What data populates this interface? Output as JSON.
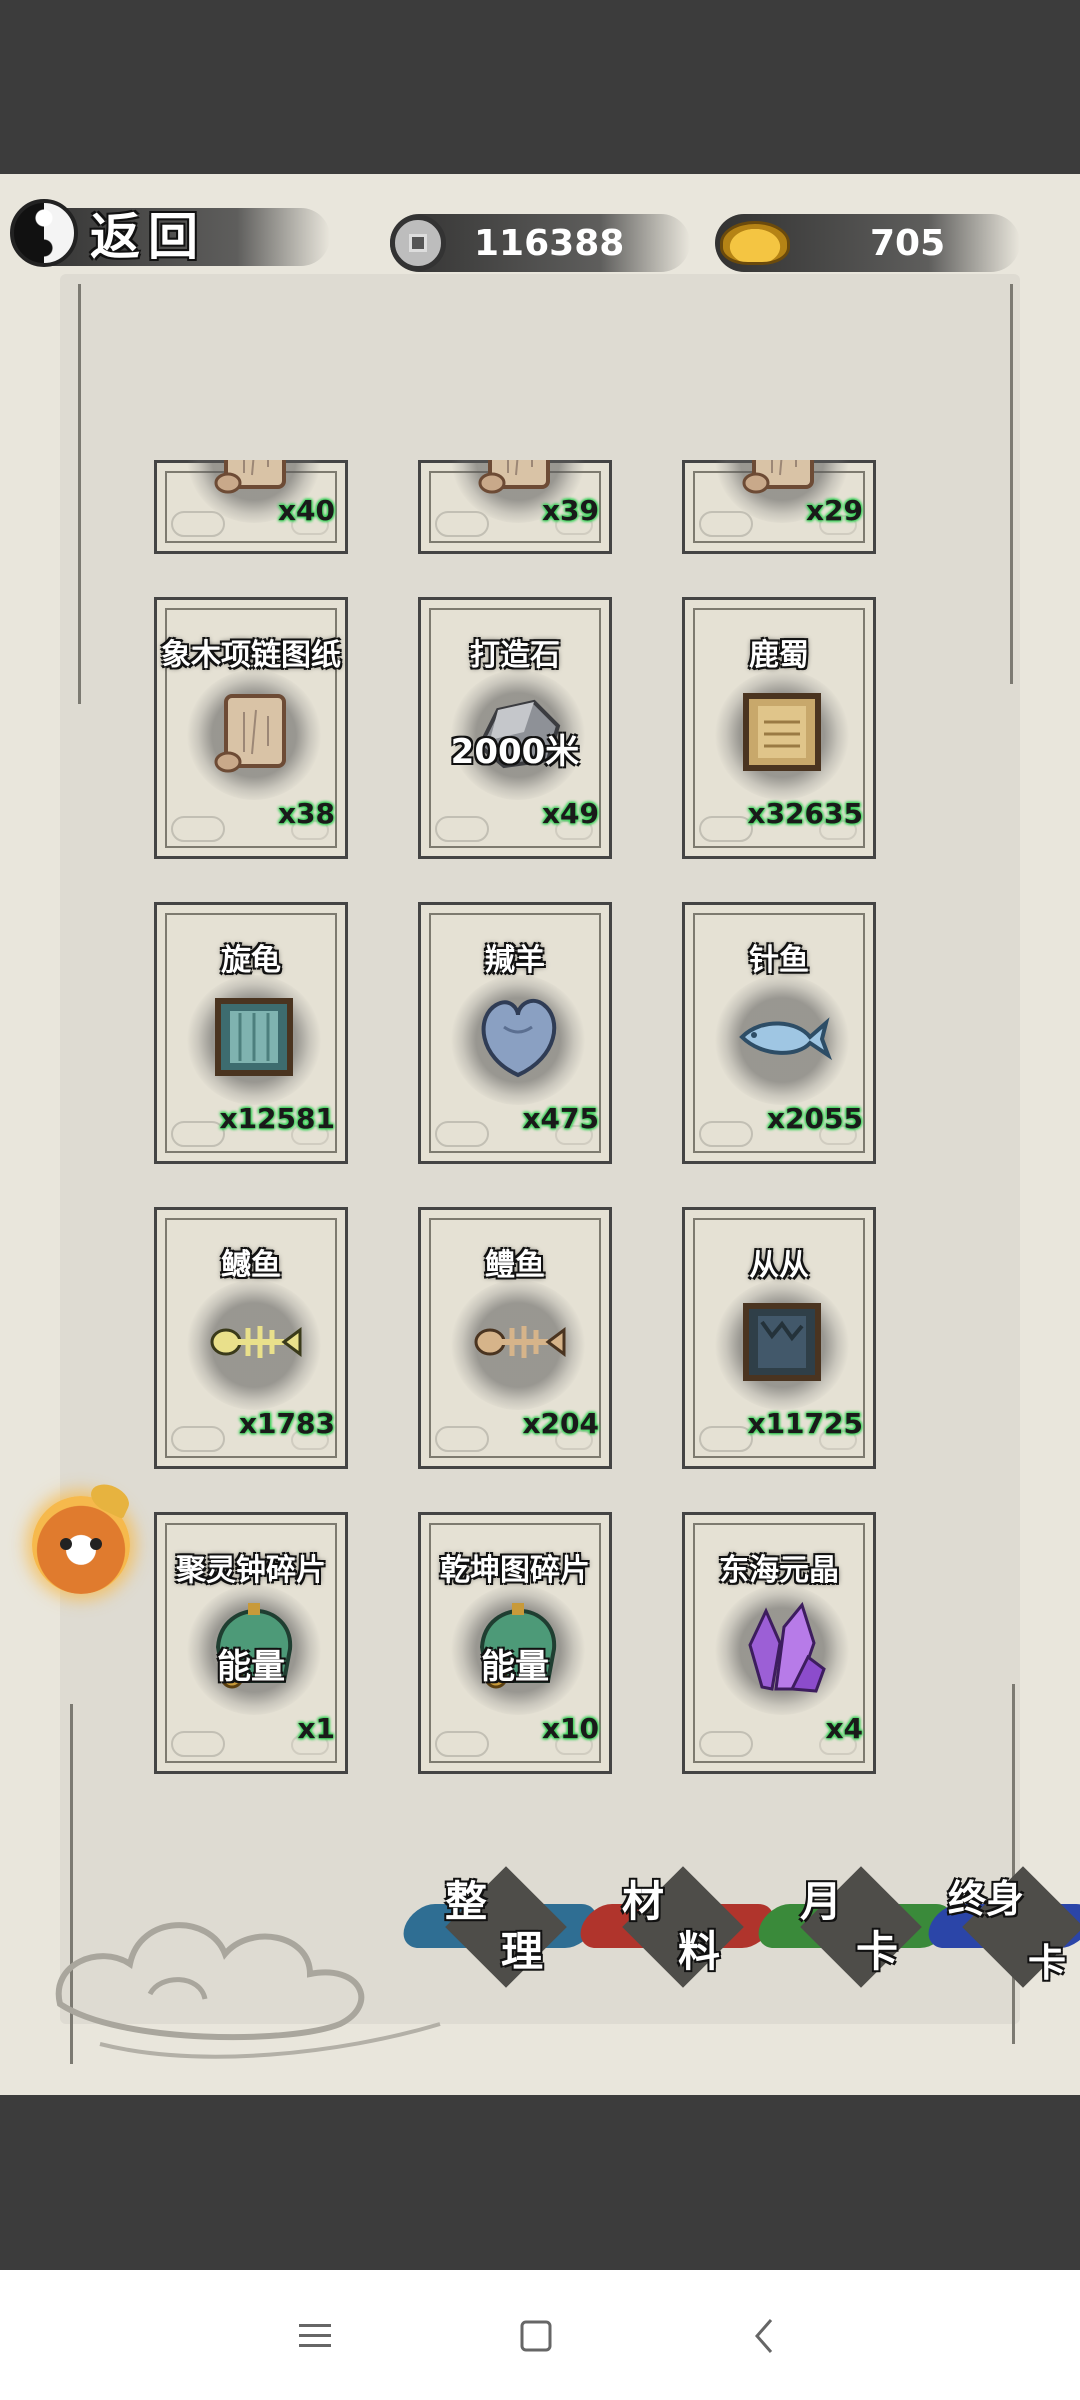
{
  "header": {
    "back_label": "返回",
    "coins": "116388",
    "gold": "705"
  },
  "items": [
    {
      "name": "",
      "count": "x40",
      "art": "scroll-icon",
      "partial": true
    },
    {
      "name": "",
      "count": "x39",
      "art": "scroll-icon",
      "partial": true
    },
    {
      "name": "",
      "count": "x29",
      "art": "scroll-icon",
      "partial": true
    },
    {
      "name": "象木项链图纸",
      "count": "x38",
      "art": "scroll-icon",
      "overlay": ""
    },
    {
      "name": "打造石",
      "count": "x49",
      "art": "stone-icon",
      "overlay": "2000米"
    },
    {
      "name": "鹿蜀",
      "count": "x32635",
      "art": "framed-hide-tan-icon",
      "overlay": ""
    },
    {
      "name": "旋龟",
      "count": "x12581",
      "art": "framed-hide-teal-icon",
      "overlay": ""
    },
    {
      "name": "羬羊",
      "count": "x475",
      "art": "heart-organ-icon",
      "overlay": ""
    },
    {
      "name": "针鱼",
      "count": "x2055",
      "art": "fish-blue-icon",
      "overlay": ""
    },
    {
      "name": "鳡鱼",
      "count": "x1783",
      "art": "fish-bone-yellow-icon",
      "overlay": ""
    },
    {
      "name": "鳢鱼",
      "count": "x204",
      "art": "fish-bone-tan-icon",
      "overlay": ""
    },
    {
      "name": "从从",
      "count": "x11725",
      "art": "framed-hide-dark-icon",
      "overlay": ""
    },
    {
      "name": "聚灵钟碎片",
      "count": "x1",
      "art": "bell-shard-icon",
      "overlay": "能量"
    },
    {
      "name": "乾坤图碎片",
      "count": "x10",
      "art": "bell-shard-icon",
      "overlay": "能量"
    },
    {
      "name": "东海元晶",
      "count": "x4",
      "art": "crystal-icon",
      "overlay": ""
    }
  ],
  "tabs": [
    {
      "c1": "整",
      "c2": "理",
      "color": "#2f6e93"
    },
    {
      "c1": "材",
      "c2": "料",
      "color": "#b0342c"
    },
    {
      "c1": "月",
      "c2": "卡",
      "color": "#3a8a3a"
    },
    {
      "c1": "终身",
      "c2": "卡",
      "color": "#2b45a8"
    }
  ]
}
